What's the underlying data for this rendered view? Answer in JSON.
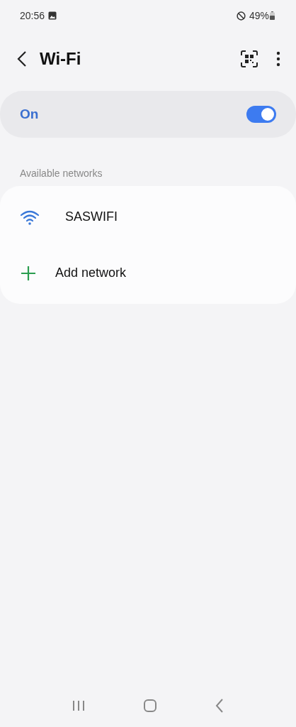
{
  "status_bar": {
    "time": "20:56",
    "battery": "49%"
  },
  "header": {
    "title": "Wi-Fi"
  },
  "master_switch": {
    "label": "On",
    "on": true
  },
  "section": {
    "title": "Available networks"
  },
  "items": [
    {
      "kind": "network",
      "label": "SASWIFI"
    },
    {
      "kind": "add",
      "label": "Add network"
    }
  ]
}
